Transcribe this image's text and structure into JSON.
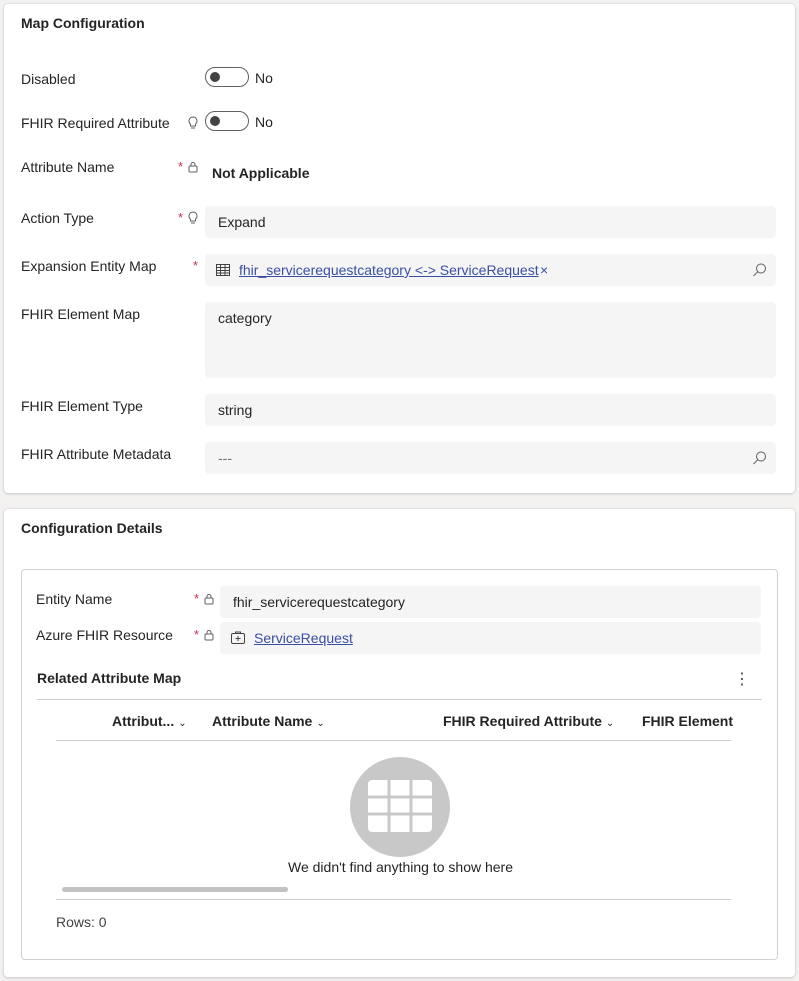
{
  "map_config": {
    "title": "Map Configuration",
    "disabled": {
      "label": "Disabled",
      "value": "No"
    },
    "fhir_required": {
      "label": "FHIR Required Attribute",
      "value": "No"
    },
    "attribute_name": {
      "label": "Attribute Name",
      "value": "Not Applicable"
    },
    "action_type": {
      "label": "Action Type",
      "value": "Expand"
    },
    "expansion_entity_map": {
      "label": "Expansion Entity Map",
      "value": "fhir_servicerequestcategory <-> ServiceRequest",
      "remove": "×"
    },
    "fhir_element_map": {
      "label": "FHIR Element Map",
      "value": "category"
    },
    "fhir_element_type": {
      "label": "FHIR Element Type",
      "value": "string"
    },
    "fhir_attribute_metadata": {
      "label": "FHIR Attribute Metadata",
      "value": "---"
    }
  },
  "config_details": {
    "title": "Configuration Details",
    "entity_name": {
      "label": "Entity Name",
      "value": "fhir_servicerequestcategory"
    },
    "azure_fhir_resource": {
      "label": "Azure FHIR Resource",
      "value": "ServiceRequest"
    },
    "related": {
      "title": "Related Attribute Map",
      "more": "⋮",
      "columns": [
        "Attribut...",
        "Attribute Name",
        "FHIR Required Attribute",
        "FHIR Element"
      ],
      "empty_message": "We didn't find anything to show here",
      "rows_label": "Rows: 0"
    }
  },
  "colors": {
    "required": "#c4314b",
    "link": "#3a4ea6",
    "field_bg": "#f5f5f5"
  },
  "icons": [
    "lightbulb-icon",
    "lock-icon",
    "search-icon",
    "table-icon",
    "resource-icon",
    "empty-grid-icon"
  ]
}
